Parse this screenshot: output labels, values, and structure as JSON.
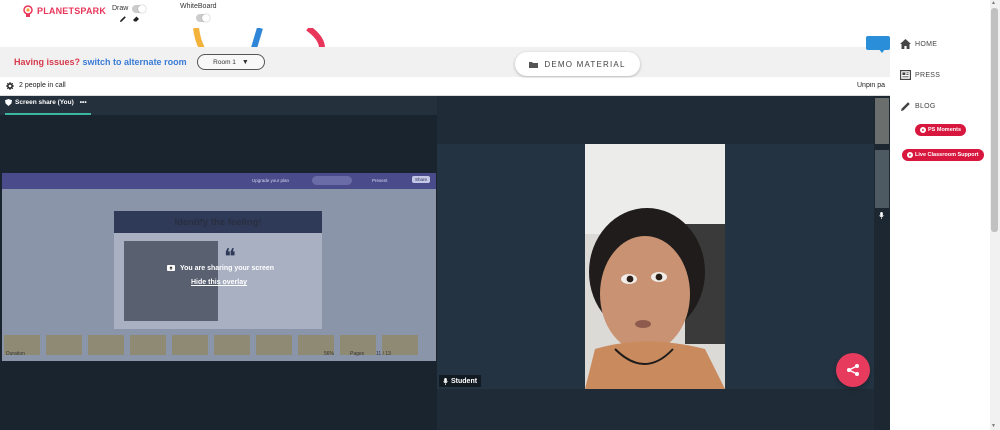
{
  "topbar": {
    "logo_text": "PLANETSPARK",
    "draw_label": "Draw",
    "whiteboard_label": "WhiteBoard",
    "draw_toggle_on": false,
    "whiteboard_toggle_on": false
  },
  "issue_bar": {
    "prefix": "Having issues?",
    "link": "switch to alternate room",
    "room_value": "Room 1"
  },
  "demo_button": {
    "label": "DEMO MATERIAL"
  },
  "call_strip": {
    "participants": "2 people in call",
    "unpin": "Unpin pa"
  },
  "screen_share": {
    "tab_label": "Screen share (You)",
    "overlay_message": "You are sharing your screen",
    "overlay_link": "Hide this overlay",
    "shared_content": {
      "slide_title": "Identify the feeling!",
      "toolbar_upgrade": "Upgrade your plan",
      "toolbar_present": "Present",
      "toolbar_share": "Share",
      "footer_left": "Duration",
      "footer_zoom": "56%",
      "footer_pages": "Pages",
      "footer_count": "11 / 13"
    }
  },
  "video_tile": {
    "name": "Student"
  },
  "sidebar": {
    "items": [
      {
        "label": "HOME",
        "icon": "home-icon"
      },
      {
        "label": "PRESS",
        "icon": "newspaper-icon"
      },
      {
        "label": "BLOG",
        "icon": "pencil-icon"
      }
    ],
    "pills": [
      {
        "label": "PS Moments"
      },
      {
        "label": "Live Classroom Support"
      }
    ]
  },
  "colors": {
    "accent_red": "#e73b5e",
    "link_blue": "#3a7bd5",
    "call_bg": "#1f2b36"
  }
}
